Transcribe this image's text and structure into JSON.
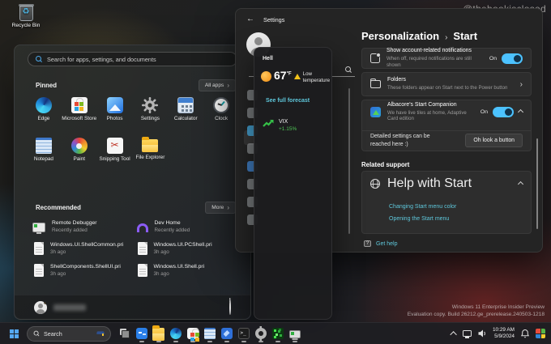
{
  "desktop": {
    "recycle_bin_label": "Recycle Bin",
    "handle_watermark": "@thebookisclosed",
    "eval_watermark_line1": "Windows 11 Enterprise Insider Preview",
    "eval_watermark_line2": "Evaluation copy. Build 26212.ge_prerelease.240503-1218"
  },
  "start_menu": {
    "search_placeholder": "Search for apps, settings, and documents",
    "pinned_heading": "Pinned",
    "all_apps_button": "All apps",
    "chevron": "›",
    "recommended_heading": "Recommended",
    "more_button": "More",
    "pinned_apps": [
      {
        "label": "Edge",
        "icon": "edge-icon"
      },
      {
        "label": "Microsoft Store",
        "icon": "microsoft-store-icon"
      },
      {
        "label": "Photos",
        "icon": "photos-icon"
      },
      {
        "label": "Settings",
        "icon": "settings-gear-icon"
      },
      {
        "label": "Calculator",
        "icon": "calculator-icon"
      },
      {
        "label": "Clock",
        "icon": "clock-icon"
      },
      {
        "label": "Notepad",
        "icon": "notepad-icon"
      },
      {
        "label": "Paint",
        "icon": "paint-icon"
      },
      {
        "label": "Snipping Tool",
        "icon": "snipping-tool-icon"
      },
      {
        "label": "File Explorer",
        "icon": "file-explorer-icon"
      }
    ],
    "recommended_items": [
      {
        "title": "Remote Debugger",
        "subtitle": "Recently added",
        "icon": "remote-debugger-icon"
      },
      {
        "title": "Dev Home",
        "subtitle": "Recently added",
        "icon": "dev-home-icon"
      },
      {
        "title": "Windows.UI.ShellCommon.pri",
        "subtitle": "3h ago",
        "icon": "document-icon"
      },
      {
        "title": "Windows.UI.PCShell.pri",
        "subtitle": "3h ago",
        "icon": "document-icon"
      },
      {
        "title": "ShellComponents.ShellUI.pri",
        "subtitle": "3h ago",
        "icon": "document-icon"
      },
      {
        "title": "Windows.UI.Shell.pri",
        "subtitle": "3h ago",
        "icon": "document-icon"
      }
    ]
  },
  "widgets_flyout": {
    "location": "Hell",
    "temperature": "67",
    "unit": "°F",
    "alert": "Low temperature",
    "forecast_link": "See full forecast",
    "stock_symbol": "VIX",
    "stock_change": "+1.15%"
  },
  "settings": {
    "window_title": "Settings",
    "back_arrow": "←",
    "breadcrumb_parent": "Personalization",
    "breadcrumb_separator": "›",
    "breadcrumb_current": "Start",
    "rows": {
      "notifications": {
        "title": "Show account-related notifications",
        "subtitle": "When off, required notifications are still shown",
        "toggle_state": "On"
      },
      "folders": {
        "title": "Folders",
        "subtitle": "These folders appear on Start next to the Power button",
        "chevron": "›"
      },
      "companion": {
        "title": "Albacore's Start Companion",
        "subtitle": "We have live tiles at home, Adaptive Card edition",
        "toggle_state": "On"
      },
      "companion_detail": {
        "text": "Detailed settings can be reached here :)",
        "button_label": "Oh look a button"
      }
    },
    "related_support_heading": "Related support",
    "help_card_title": "Help with Start",
    "help_links": [
      "Changing Start menu color",
      "Opening the Start menu"
    ],
    "get_help_label": "Get help",
    "accent_color": "#4cc2ff",
    "link_color": "#5fc8dc"
  },
  "taskbar": {
    "search_label": "Search",
    "clock_time": "10:29 AM",
    "clock_date": "5/9/2024",
    "app_icons": [
      "task-view",
      "blue-app",
      "file-explorer",
      "edge",
      "microsoft-store",
      "notepad",
      "feedback-hub",
      "terminal",
      "settings-gear",
      "green-app",
      "remote-debugger"
    ]
  }
}
